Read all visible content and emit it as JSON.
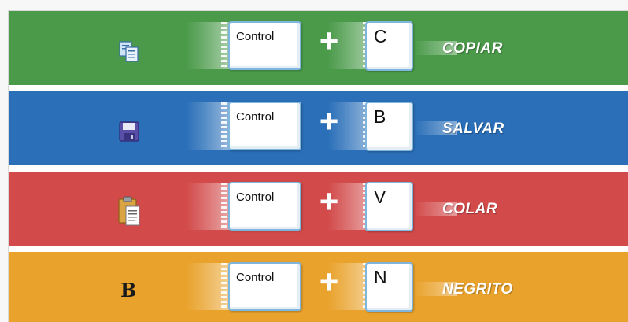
{
  "shortcuts": [
    {
      "icon": "copy-icon",
      "modifier": "Control",
      "plus": "+",
      "key": "C",
      "action": "COPIAR",
      "color": "#4a9a4a"
    },
    {
      "icon": "save-icon",
      "modifier": "Control",
      "plus": "+",
      "key": "B",
      "action": "SALVAR",
      "color": "#2a6fb8"
    },
    {
      "icon": "paste-icon",
      "modifier": "Control",
      "plus": "+",
      "key": "V",
      "action": "COLAR",
      "color": "#d24a4a"
    },
    {
      "icon": "bold-icon",
      "modifier": "Control",
      "plus": "+",
      "key": "N",
      "action": "NEGRITO",
      "color": "#e9a22c"
    }
  ]
}
